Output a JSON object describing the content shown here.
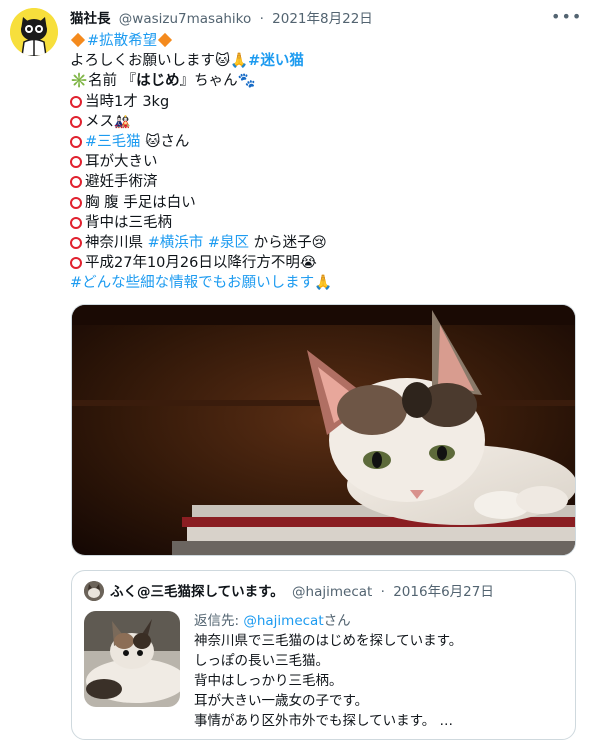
{
  "tweet": {
    "author_name": "猫社長",
    "author_handle": "@wasizu7masahiko",
    "separator": "·",
    "date": "2021年8月22日",
    "more_label": "•••",
    "lines": {
      "l1_tag": "#拡散希望",
      "l2_text": "よろしくお願いします🐱🙏",
      "l2_tag": "#迷い猫",
      "l3_prefix": "名前 『",
      "l3_name": "はじめ",
      "l3_suffix": "』ちゃん🐾",
      "l4": "当時1才 3kg",
      "l5": "メス",
      "l6_tag": "#三毛猫",
      "l6_suffix": " 🐱さん",
      "l7": "耳が大きい",
      "l8": "避妊手術済",
      "l9": "胸 腹 手足は白い",
      "l10": "背中は三毛柄",
      "l11_prefix": "神奈川県 ",
      "l11_tag1": "#横浜市",
      "l11_tag2": "#泉区",
      "l11_suffix": " から迷子😢",
      "l12": "平成27年10月26日以降行方不明😭",
      "l13_tag": "#どんな些細な情報でもお願いします",
      "l13_suffix": "🙏"
    }
  },
  "quoted": {
    "author_name": "ふく@三毛猫探しています。",
    "author_handle": "@hajimecat",
    "separator": "·",
    "date": "2016年6月27日",
    "reply_prefix": "返信先: ",
    "reply_handle": "@hajimecat",
    "reply_suffix": "さん",
    "lines": [
      "神奈川県で三毛猫のはじめを探しています。",
      "しっぽの長い三毛猫。",
      "背中はしっかり三毛柄。",
      "耳が大きい一歳女の子です。",
      "事情があり区外市外でも探しています。 …"
    ]
  },
  "colors": {
    "link": "#1d9bf0",
    "text": "#0f1419",
    "secondary": "#536471",
    "border": "#cfd9de",
    "ring": "#e0222f",
    "diamond": "#f48a1d"
  },
  "icons": [
    "avatar-cat-mascot",
    "more-icon",
    "orange-diamond-icon",
    "red-circle-icon",
    "sparkle-icon"
  ]
}
